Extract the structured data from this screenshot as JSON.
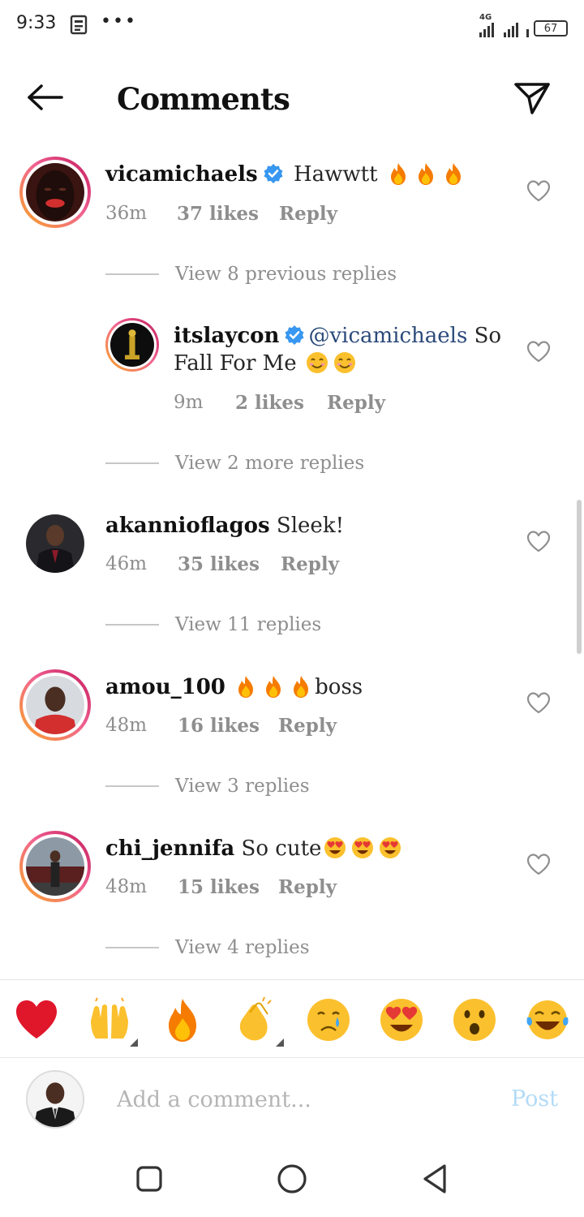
{
  "status_bar": {
    "time": "9:33",
    "dots": "•••",
    "network": "4G",
    "battery": "67"
  },
  "header": {
    "title": "Comments",
    "back_icon": "arrow-left-icon",
    "send_icon": "paper-plane-icon"
  },
  "comments": [
    {
      "username": "vicamichaels",
      "verified": true,
      "text": " Hawwtt ",
      "emoji_after": [
        "fire",
        "fire",
        "fire"
      ],
      "time": "36m",
      "likes": "37 likes",
      "reply": "Reply",
      "view_replies": "View 8 previous replies"
    },
    {
      "username": "itslaycon",
      "verified": true,
      "mention": "@vicamichaels",
      "text_line1": " So",
      "text_line2": "Fall For Me ",
      "emoji_after": [
        "smiling-face",
        "smiling-face"
      ],
      "time": "9m",
      "likes": "2 likes",
      "reply": "Reply",
      "view_replies": "View 2 more replies"
    },
    {
      "username": "akannioflagos",
      "verified": false,
      "text": " Sleek!",
      "time": "46m",
      "likes": "35 likes",
      "reply": "Reply",
      "view_replies": "View 11 replies"
    },
    {
      "username": "amou_100",
      "verified": false,
      "text": "boss",
      "emoji_before": [
        "fire",
        "fire",
        "fire"
      ],
      "time": "48m",
      "likes": "16 likes",
      "reply": "Reply",
      "view_replies": "View 3 replies"
    },
    {
      "username": "chi_jennifa",
      "verified": false,
      "text": " So cute",
      "emoji_after": [
        "heart-eyes",
        "heart-eyes",
        "heart-eyes"
      ],
      "time": "48m",
      "likes": "15 likes",
      "reply": "Reply",
      "view_replies": "View 4 replies"
    }
  ],
  "reactions": [
    "red-heart",
    "raising-hands",
    "fire",
    "clapping-hands",
    "crying-face",
    "heart-eyes",
    "surprised-face",
    "tears-of-joy"
  ],
  "compose": {
    "placeholder": "Add a comment...",
    "post_label": "Post"
  },
  "colors": {
    "accent_post_disabled": "#b3dbf7",
    "verified_blue": "#3897f0",
    "meta_gray": "#8e8e8e",
    "story_ring_start": "#f9a825",
    "story_ring_end": "#c2185b"
  }
}
